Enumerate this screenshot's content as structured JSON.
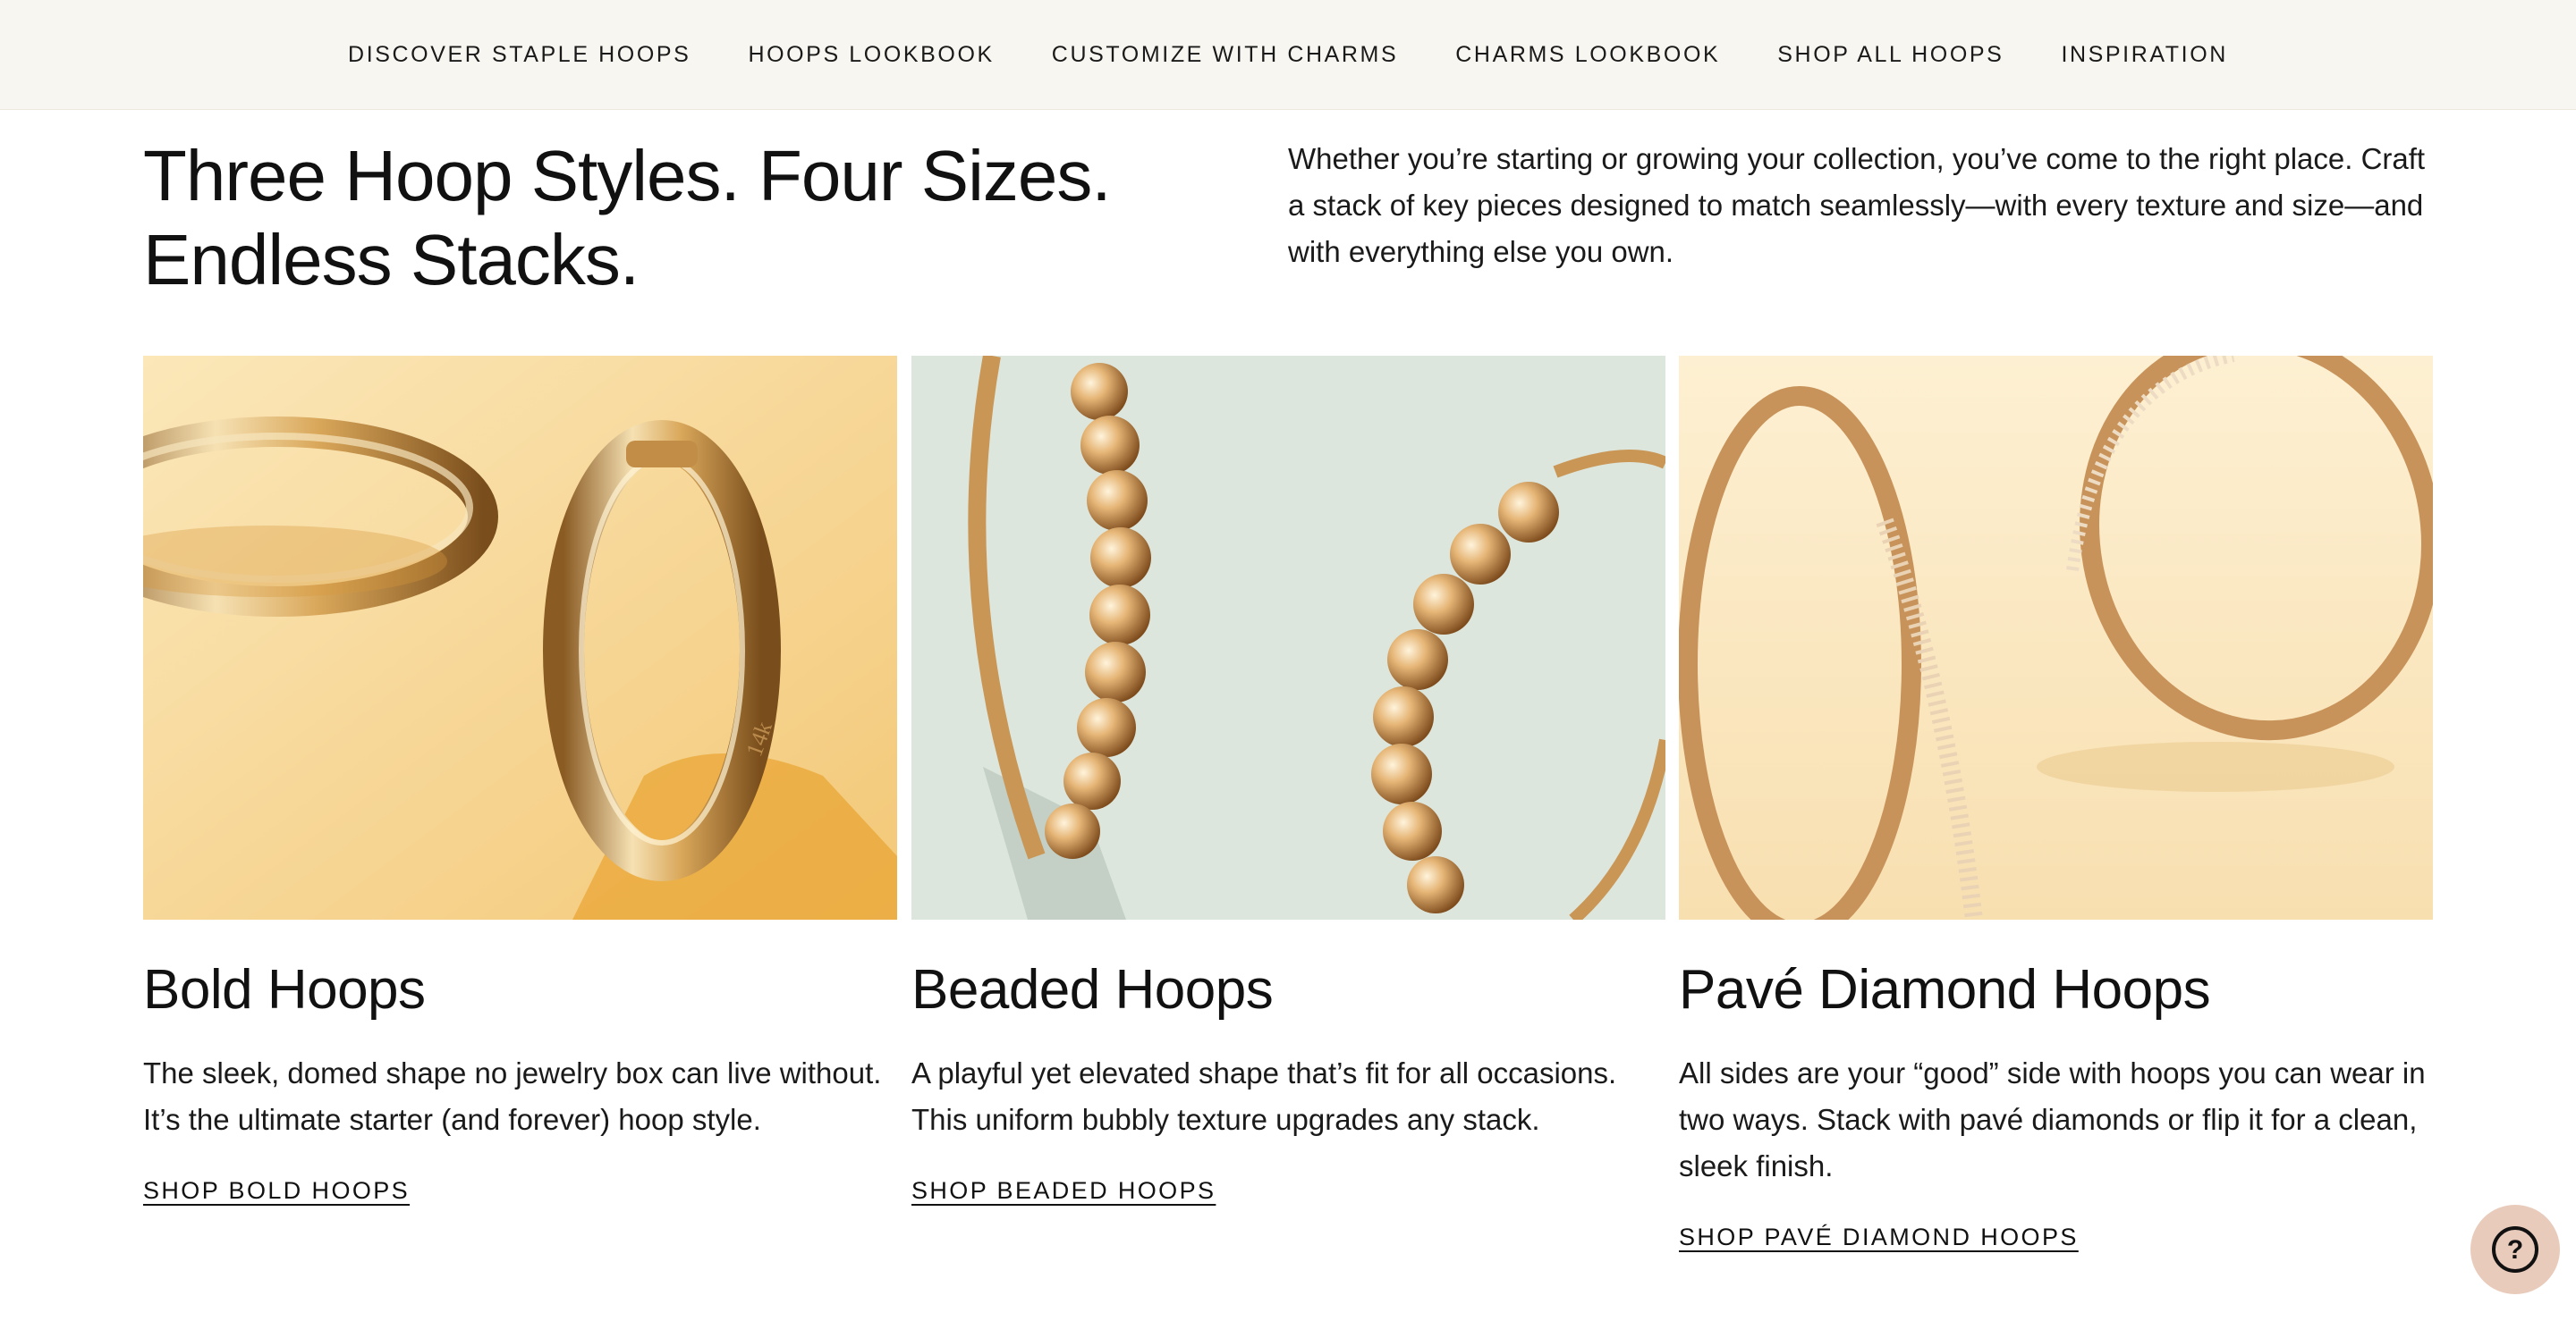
{
  "nav": {
    "items": [
      "DISCOVER STAPLE HOOPS",
      "HOOPS LOOKBOOK",
      "CUSTOMIZE WITH CHARMS",
      "CHARMS LOOKBOOK",
      "SHOP ALL HOOPS",
      "INSPIRATION"
    ]
  },
  "hero": {
    "headline_line1": "Three Hoop Styles. Four Sizes.",
    "headline_line2": "Endless Stacks.",
    "intro": "Whether you’re starting or growing your collection, you’ve come to the right place. Craft a stack of key pieces designed to match seamlessly—with every texture and size—and with everything else you own."
  },
  "cards": [
    {
      "title": "Bold Hoops",
      "description": "The sleek, domed shape no jewelry box can live without. It’s the ultimate starter (and forever) hoop style.",
      "link": "SHOP BOLD HOOPS",
      "image_engraving": "14k",
      "bg_color": "#f6dca6"
    },
    {
      "title": "Beaded Hoops",
      "description": "A playful yet elevated shape that’s fit for all occasions. This uniform bubbly texture upgrades any stack.",
      "link": "SHOP BEADED HOOPS",
      "bg_color": "#dde6dc"
    },
    {
      "title": "Pavé Diamond Hoops",
      "description": "All sides are your “good” side with hoops you can wear in two ways. Stack with pavé diamonds or flip it for a clean, sleek finish.",
      "link": "SHOP PAVÉ DIAMOND HOOPS",
      "bg_color": "#fbe8c4"
    }
  ],
  "help": {
    "icon": "question-mark-icon",
    "label": "?"
  },
  "colors": {
    "nav_bg": "#f8f6f0",
    "gold": "#d9a45c",
    "help_bg": "#e9cbbb"
  }
}
